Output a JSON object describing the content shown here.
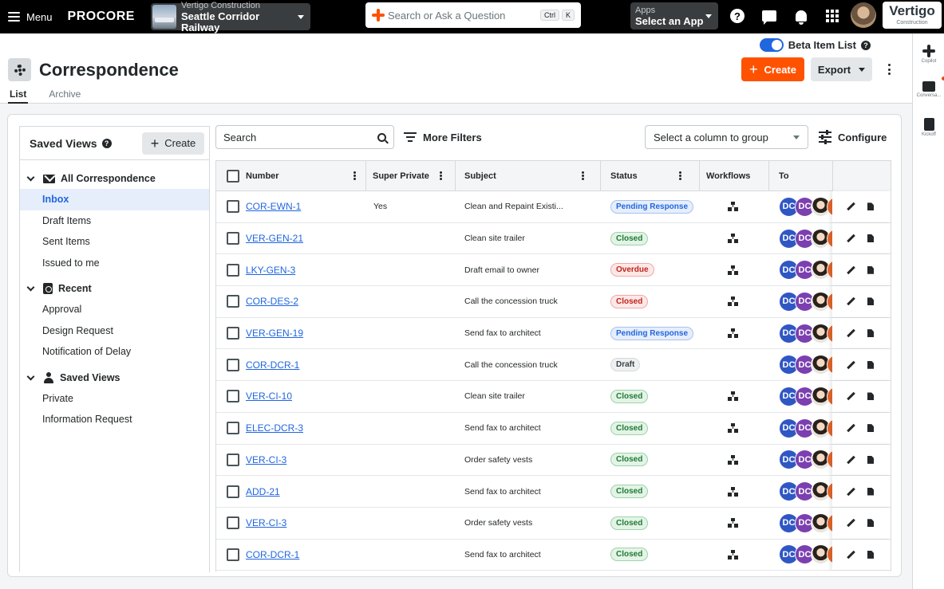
{
  "topbar": {
    "menu_label": "Menu",
    "logo": "PROCORE",
    "project_company": "Vertigo Construction",
    "project_name": "Seattle Corridor Railway",
    "search_placeholder": "Search or Ask a Question",
    "search_shortcut": [
      "Ctrl",
      "K"
    ],
    "apps_label": "Apps",
    "apps_value": "Select an App",
    "company_logo": "Vertigo",
    "company_logo_sub": "Construction",
    "icons": [
      "help-icon",
      "chat-icon",
      "notifications-icon",
      "apps-grid-icon"
    ]
  },
  "right_rail": {
    "items": [
      {
        "label": "Copilot",
        "icon": "copilot-icon"
      },
      {
        "label": "Conversa...",
        "icon": "conversations-icon"
      },
      {
        "label": "Kickoff",
        "icon": "kickoff-icon"
      }
    ]
  },
  "header": {
    "beta_label": "Beta Item List",
    "beta_enabled": true,
    "title": "Correspondence",
    "tabs": [
      "List",
      "Archive"
    ],
    "active_tab": "List",
    "create_label": "Create",
    "export_label": "Export"
  },
  "sidebar": {
    "title": "Saved Views",
    "create_label": "Create",
    "groups": [
      {
        "label": "All Correspondence",
        "icon": "envelope-icon",
        "items": [
          "Inbox",
          "Draft Items",
          "Sent Items",
          "Issued to me"
        ]
      },
      {
        "label": "Recent",
        "icon": "recent-icon",
        "items": [
          "Approval",
          "Design Request",
          "Notification of Delay"
        ]
      },
      {
        "label": "Saved Views",
        "icon": "person-icon",
        "items": [
          "Private",
          "Information Request"
        ]
      }
    ],
    "active_item": "Inbox"
  },
  "toolbar": {
    "search_placeholder": "Search",
    "filters_label": "More Filters",
    "group_placeholder": "Select a column to group",
    "configure_label": "Configure"
  },
  "table": {
    "columns": [
      "Number",
      "Super Private",
      "Subject",
      "Status",
      "Workflows",
      "To"
    ],
    "rows": [
      {
        "number": "COR-EWN-1",
        "super_private": "Yes",
        "subject": "Clean and Repaint Existi...",
        "status": "Pending Response",
        "status_kind": "pending",
        "workflow": true
      },
      {
        "number": "VER-GEN-21",
        "super_private": "",
        "subject": "Clean site trailer",
        "status": "Closed",
        "status_kind": "closed",
        "workflow": true
      },
      {
        "number": "LKY-GEN-3",
        "super_private": "",
        "subject": "Draft email to owner",
        "status": "Overdue",
        "status_kind": "overdue",
        "workflow": true
      },
      {
        "number": "COR-DES-2",
        "super_private": "",
        "subject": "Call the concession truck",
        "status": "Closed",
        "status_kind": "overdue",
        "workflow": true
      },
      {
        "number": "VER-GEN-19",
        "super_private": "",
        "subject": "Send fax to architect",
        "status": "Pending Response",
        "status_kind": "pending",
        "workflow": true
      },
      {
        "number": "COR-DCR-1",
        "super_private": "",
        "subject": "Call the concession truck",
        "status": "Draft",
        "status_kind": "draft",
        "workflow": false
      },
      {
        "number": "VER-CI-10",
        "super_private": "",
        "subject": "Clean site trailer",
        "status": "Closed",
        "status_kind": "closed",
        "workflow": true
      },
      {
        "number": "ELEC-DCR-3",
        "super_private": "",
        "subject": "Send fax to architect",
        "status": "Closed",
        "status_kind": "closed",
        "workflow": true
      },
      {
        "number": "VER-CI-3",
        "super_private": "",
        "subject": "Order safety vests",
        "status": "Closed",
        "status_kind": "closed",
        "workflow": true
      },
      {
        "number": "ADD-21",
        "super_private": "",
        "subject": "Send fax to architect",
        "status": "Closed",
        "status_kind": "closed",
        "workflow": true
      },
      {
        "number": "VER-CI-3",
        "super_private": "",
        "subject": "Order safety vests",
        "status": "Closed",
        "status_kind": "closed",
        "workflow": true
      },
      {
        "number": "COR-DCR-1",
        "super_private": "",
        "subject": "Send fax to architect",
        "status": "Closed",
        "status_kind": "closed",
        "workflow": true
      }
    ],
    "avatar_initials": [
      "DC",
      "DC"
    ]
  },
  "colors": {
    "brand_orange": "#ff5200",
    "link_blue": "#2066df",
    "topbar_bg": "#000000"
  }
}
